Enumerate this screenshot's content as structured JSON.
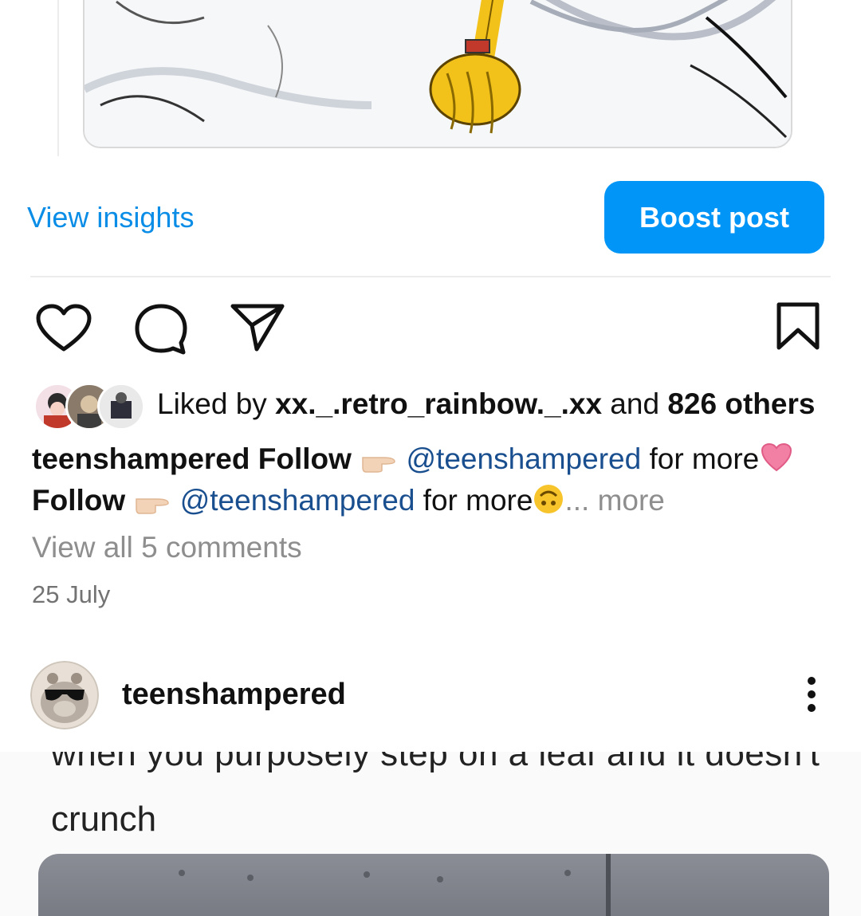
{
  "actions": {
    "view_insights": "View insights",
    "boost_post": "Boost post"
  },
  "likes": {
    "prefix": "Liked by ",
    "user": "xx._.retro_rainbow._.xx",
    "middle": " and ",
    "others": "826 others"
  },
  "caption": {
    "username": "teenshampered",
    "follow_1": "Follow",
    "mention_1": "@teenshampered",
    "text_1": " for more",
    "follow_2": "Follow",
    "mention_2": "@teenshampered",
    "text_2": " for more",
    "ellipsis": "... ",
    "more": "more"
  },
  "comments": {
    "view_all": "View all 5 comments"
  },
  "post_date": "25 July",
  "next_post": {
    "username": "teenshampered",
    "meme_line1": "when you purposely step on a leaf and it doesn't",
    "meme_line2": "crunch"
  },
  "colors": {
    "accent_blue": "#0095f6",
    "link_blue": "#0a8de6",
    "mention_blue": "#1a4f8f",
    "muted_gray": "#8e8e8e"
  },
  "icons": [
    "heart-icon",
    "comment-icon",
    "share-icon",
    "save-icon",
    "more-options-icon",
    "pointing-hand-emoji",
    "heart-emoji",
    "upside-down-face-emoji"
  ]
}
